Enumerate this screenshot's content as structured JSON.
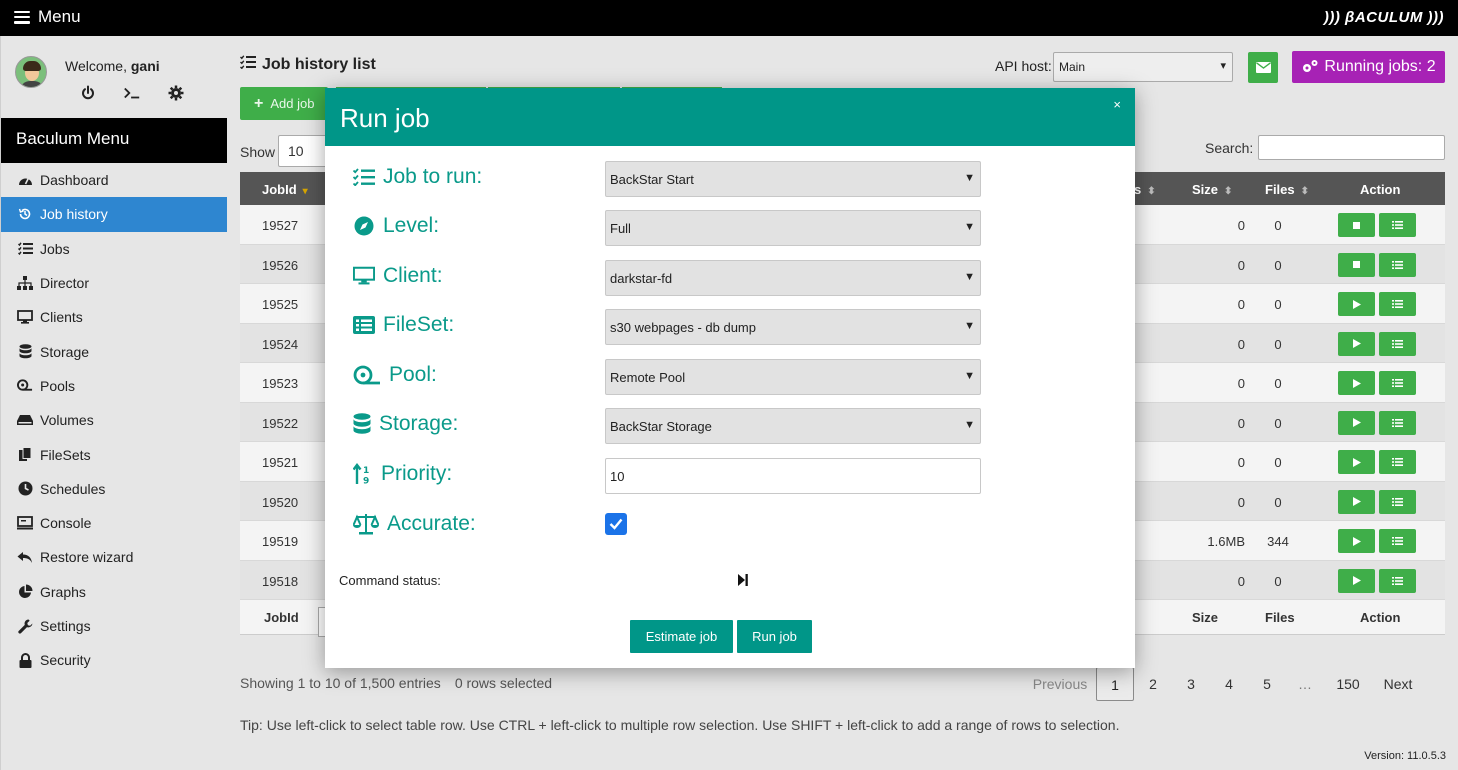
{
  "topbar": {
    "menu_label": "Menu",
    "logo": "))) βACULUM )))"
  },
  "user": {
    "welcome_prefix": "Welcome,",
    "username": "gani"
  },
  "sidebar": {
    "title": "Baculum Menu",
    "items": [
      {
        "label": "Dashboard",
        "icon": "dashboard-icon"
      },
      {
        "label": "Job history",
        "icon": "history-icon",
        "active": true
      },
      {
        "label": "Jobs",
        "icon": "tasks-icon"
      },
      {
        "label": "Director",
        "icon": "sitemap-icon"
      },
      {
        "label": "Clients",
        "icon": "desktop-icon"
      },
      {
        "label": "Storage",
        "icon": "database-icon"
      },
      {
        "label": "Pools",
        "icon": "tape-icon"
      },
      {
        "label": "Volumes",
        "icon": "hdd-icon"
      },
      {
        "label": "FileSets",
        "icon": "copy-icon"
      },
      {
        "label": "Schedules",
        "icon": "clock-icon"
      },
      {
        "label": "Console",
        "icon": "terminal-icon"
      },
      {
        "label": "Restore wizard",
        "icon": "reply-icon"
      },
      {
        "label": "Graphs",
        "icon": "pie-chart-icon"
      },
      {
        "label": "Settings",
        "icon": "wrench-icon"
      },
      {
        "label": "Security",
        "icon": "lock-icon"
      }
    ]
  },
  "header": {
    "title": "Job history list",
    "api_host_label": "API host:",
    "api_host_value": "Main",
    "running_jobs": "Running jobs: 2",
    "add_job": "Add job"
  },
  "table": {
    "show_label": "Show",
    "show_value": "10",
    "search_label": "Search:",
    "columns": {
      "jobid": "JobId",
      "status_tail": "s",
      "size": "Size",
      "files": "Files",
      "action": "Action"
    },
    "rows": [
      {
        "jobid": "19527",
        "size": "0",
        "files": "0",
        "state": "running"
      },
      {
        "jobid": "19526",
        "size": "0",
        "files": "0",
        "state": "running"
      },
      {
        "jobid": "19525",
        "size": "0",
        "files": "0",
        "state": "done"
      },
      {
        "jobid": "19524",
        "size": "0",
        "files": "0",
        "state": "done"
      },
      {
        "jobid": "19523",
        "size": "0",
        "files": "0",
        "state": "done"
      },
      {
        "jobid": "19522",
        "size": "0",
        "files": "0",
        "state": "done"
      },
      {
        "jobid": "19521",
        "size": "0",
        "files": "0",
        "state": "done"
      },
      {
        "jobid": "19520",
        "size": "0",
        "files": "0",
        "state": "done"
      },
      {
        "jobid": "19519",
        "size": "1.6MB",
        "files": "344",
        "state": "done"
      },
      {
        "jobid": "19518",
        "size": "0",
        "files": "0",
        "state": "done"
      }
    ],
    "footer": {
      "jobid": "JobId",
      "size": "Size",
      "files": "Files",
      "action": "Action"
    },
    "info": "Showing 1 to 10 of 1,500 entries",
    "selected": "0 rows selected"
  },
  "pager": {
    "previous": "Previous",
    "pages": [
      "1",
      "2",
      "3",
      "4",
      "5"
    ],
    "ellipsis": "…",
    "last": "150",
    "next": "Next",
    "current": "1"
  },
  "tip": "Tip: Use left-click to select table row. Use CTRL + left-click to multiple row selection. Use SHIFT + left-click to add a range of rows to selection.",
  "version": "Version: 11.0.5.3",
  "modal": {
    "title": "Run job",
    "close": "×",
    "fields": {
      "job": {
        "label": "Job to run:",
        "value": "BackStar Start"
      },
      "level": {
        "label": "Level:",
        "value": "Full"
      },
      "client": {
        "label": "Client:",
        "value": "darkstar-fd"
      },
      "fileset": {
        "label": "FileSet:",
        "value": "s30 webpages - db dump"
      },
      "pool": {
        "label": "Pool:",
        "value": "Remote Pool"
      },
      "storage": {
        "label": "Storage:",
        "value": "BackStar Storage"
      },
      "priority": {
        "label": "Priority:",
        "value": "10"
      },
      "accurate": {
        "label": "Accurate:",
        "checked": true
      }
    },
    "command_status": "Command status:",
    "estimate_button": "Estimate job",
    "run_button": "Run job"
  },
  "colors": {
    "accent": "#009688",
    "green": "#3fae49",
    "purple": "#a722b5",
    "active_nav": "#2e86d0"
  }
}
